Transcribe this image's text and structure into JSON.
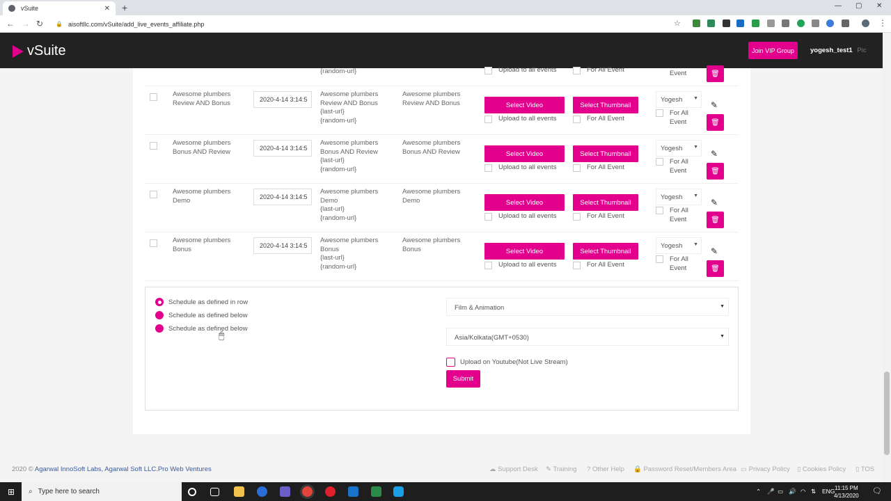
{
  "browser": {
    "tab_title": "vSuite",
    "tab_close": "✕",
    "new_tab": "+",
    "url": "aisoftllc.com/vSuite/add_live_events_affiliate.php",
    "back_icon": "←",
    "forward_icon": "→",
    "reload_icon": "↻",
    "minimize": "—",
    "maximize": "▢",
    "close": "✕",
    "star_icon": "☆"
  },
  "header": {
    "logo_text": "vSuite",
    "vip_button": "Join VIP Group",
    "username": "yogesh_test1",
    "avatar_alt": "Pic",
    "accent_color": "#e3008c"
  },
  "table": {
    "rows": [
      {
        "name": [
          "Awesome plumbers",
          "Review AND Bonus"
        ],
        "date": "2020-4-14 3:14:5",
        "desc": [
          "Awesome plumbers",
          "Review AND Bonus",
          "{last-url}",
          "{random-url}"
        ],
        "tags": [
          "Awesome plumbers",
          "Review AND Bonus"
        ],
        "select_video": "Select Video",
        "select_thumbnail": "Select Thumbnail",
        "upload_all": "Upload to all events",
        "for_all_event": "For All Event",
        "owner": "Yogesh",
        "for_all": "For All",
        "event": "Event"
      },
      {
        "name": [
          "Awesome plumbers",
          "Bonus AND Review"
        ],
        "date": "2020-4-14 3:14:5",
        "desc": [
          "Awesome plumbers",
          "Bonus AND Review",
          "{last-url}",
          "{random-url}"
        ],
        "tags": [
          "Awesome plumbers",
          "Bonus AND Review"
        ],
        "select_video": "Select Video",
        "select_thumbnail": "Select Thumbnail",
        "upload_all": "Upload to all events",
        "for_all_event": "For All Event",
        "owner": "Yogesh",
        "for_all": "For All",
        "event": "Event"
      },
      {
        "name": [
          "Awesome plumbers",
          "Demo"
        ],
        "date": "2020-4-14 3:14:5",
        "desc": [
          "Awesome plumbers",
          "Demo",
          "{last-url}",
          "{random-url}"
        ],
        "tags": [
          "Awesome plumbers",
          "Demo"
        ],
        "select_video": "Select Video",
        "select_thumbnail": "Select Thumbnail",
        "upload_all": "Upload to all events",
        "for_all_event": "For All Event",
        "owner": "Yogesh",
        "for_all": "For All",
        "event": "Event"
      },
      {
        "name": [
          "Awesome plumbers",
          "Bonus"
        ],
        "date": "2020-4-14 3:14:5",
        "desc": [
          "Awesome plumbers",
          "Bonus",
          "{last-url}",
          "{random-url}"
        ],
        "tags": [
          "Awesome plumbers",
          "Bonus"
        ],
        "select_video": "Select Video",
        "select_thumbnail": "Select Thumbnail",
        "upload_all": "Upload to all events",
        "for_all_event": "For All Event",
        "owner": "Yogesh",
        "for_all": "For All",
        "event": "Event"
      }
    ],
    "partial_row": {
      "desc": "{random-url}",
      "upload_all": "Upload to all events",
      "for_all_event": "For All Event",
      "event": "Event"
    }
  },
  "options": {
    "radio1": "Schedule as defined in row",
    "radio2": "Schedule as defined below",
    "radio3": "Schedule as defined below",
    "category": "Film & Animation",
    "timezone": "Asia/Kolkata(GMT+0530)",
    "youtube_label": "Upload on Youtube(Not Live Stream)",
    "submit": "Submit"
  },
  "footer": {
    "copyright_prefix": "2020 ©",
    "copyright_links": "Agarwal InnoSoft Labs, Agarwal Soft LLC.Pro Web Ventures",
    "support": "Support Desk",
    "training": "Training",
    "other_help": "Other Help",
    "password_reset": "Password Reset/Members Area",
    "privacy": "Privacy Policy",
    "cookies": "Cookies Policy",
    "tos": "TOS"
  },
  "taskbar": {
    "search_placeholder": "Type here to search",
    "lang": "ENG",
    "time": "11:15 PM",
    "date": "4/13/2020"
  }
}
